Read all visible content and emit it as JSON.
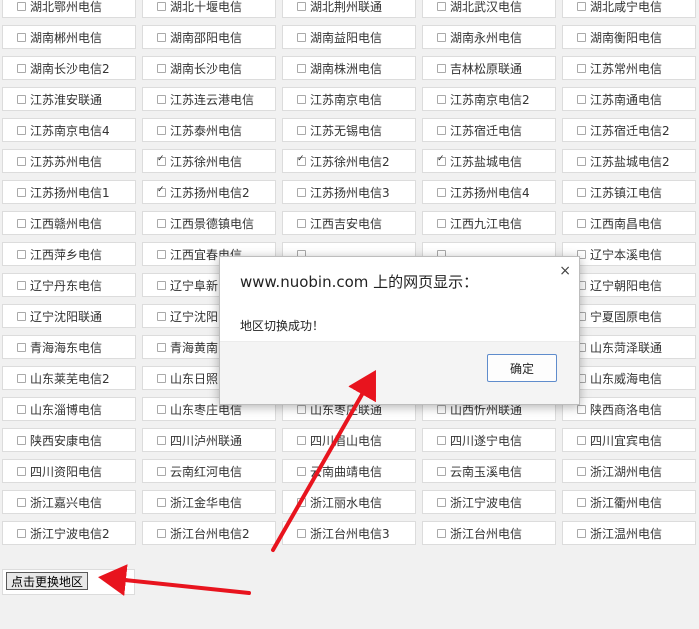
{
  "regions": [
    {
      "label": "湖北鄂州电信",
      "checked": false
    },
    {
      "label": "湖北十堰电信",
      "checked": false
    },
    {
      "label": "湖北荆州联通",
      "checked": false
    },
    {
      "label": "湖北武汉电信",
      "checked": false
    },
    {
      "label": "湖北咸宁电信",
      "checked": false
    },
    {
      "label": "湖南郴州电信",
      "checked": false
    },
    {
      "label": "湖南邵阳电信",
      "checked": false
    },
    {
      "label": "湖南益阳电信",
      "checked": false
    },
    {
      "label": "湖南永州电信",
      "checked": false
    },
    {
      "label": "湖南衡阳电信",
      "checked": false
    },
    {
      "label": "湖南长沙电信2",
      "checked": false
    },
    {
      "label": "湖南长沙电信",
      "checked": false
    },
    {
      "label": "湖南株洲电信",
      "checked": false
    },
    {
      "label": "吉林松原联通",
      "checked": false
    },
    {
      "label": "江苏常州电信",
      "checked": false
    },
    {
      "label": "江苏淮安联通",
      "checked": false
    },
    {
      "label": "江苏连云港电信",
      "checked": false
    },
    {
      "label": "江苏南京电信",
      "checked": false
    },
    {
      "label": "江苏南京电信2",
      "checked": false
    },
    {
      "label": "江苏南通电信",
      "checked": false
    },
    {
      "label": "江苏南京电信4",
      "checked": false
    },
    {
      "label": "江苏泰州电信",
      "checked": false
    },
    {
      "label": "江苏无锡电信",
      "checked": false
    },
    {
      "label": "江苏宿迁电信",
      "checked": false
    },
    {
      "label": "江苏宿迁电信2",
      "checked": false
    },
    {
      "label": "江苏苏州电信",
      "checked": false
    },
    {
      "label": "江苏徐州电信",
      "checked": true
    },
    {
      "label": "江苏徐州电信2",
      "checked": true
    },
    {
      "label": "江苏盐城电信",
      "checked": true
    },
    {
      "label": "江苏盐城电信2",
      "checked": false
    },
    {
      "label": "江苏扬州电信1",
      "checked": false
    },
    {
      "label": "江苏扬州电信2",
      "checked": true
    },
    {
      "label": "江苏扬州电信3",
      "checked": false
    },
    {
      "label": "江苏扬州电信4",
      "checked": false
    },
    {
      "label": "江苏镇江电信",
      "checked": false
    },
    {
      "label": "江西赣州电信",
      "checked": false
    },
    {
      "label": "江西景德镇电信",
      "checked": false
    },
    {
      "label": "江西吉安电信",
      "checked": false
    },
    {
      "label": "江西九江电信",
      "checked": false
    },
    {
      "label": "江西南昌电信",
      "checked": false
    },
    {
      "label": "江西萍乡电信",
      "checked": false
    },
    {
      "label": "江西宜春电信",
      "checked": false
    },
    {
      "label": "",
      "checked": false
    },
    {
      "label": "",
      "checked": false
    },
    {
      "label": "辽宁本溪电信",
      "checked": false
    },
    {
      "label": "辽宁丹东电信",
      "checked": false
    },
    {
      "label": "辽宁阜新",
      "checked": false
    },
    {
      "label": "",
      "checked": false
    },
    {
      "label": "",
      "checked": false
    },
    {
      "label": "辽宁朝阳电信",
      "checked": false
    },
    {
      "label": "辽宁沈阳联通",
      "checked": false
    },
    {
      "label": "辽宁沈阳",
      "checked": false
    },
    {
      "label": "",
      "checked": false
    },
    {
      "label": "",
      "checked": false
    },
    {
      "label": "宁夏固原电信",
      "checked": false
    },
    {
      "label": "青海海东电信",
      "checked": false
    },
    {
      "label": "青海黄南",
      "checked": false
    },
    {
      "label": "",
      "checked": false
    },
    {
      "label": "",
      "checked": false
    },
    {
      "label": "山东菏泽联通",
      "checked": false
    },
    {
      "label": "山东莱芜电信2",
      "checked": false
    },
    {
      "label": "山东日照",
      "checked": false
    },
    {
      "label": "",
      "checked": false
    },
    {
      "label": "",
      "checked": false
    },
    {
      "label": "山东威海电信",
      "checked": false
    },
    {
      "label": "山东淄博电信",
      "checked": false
    },
    {
      "label": "山东枣庄电信",
      "checked": false
    },
    {
      "label": "山东枣庄联通",
      "checked": false
    },
    {
      "label": "山西忻州联通",
      "checked": false
    },
    {
      "label": "陕西商洛电信",
      "checked": false
    },
    {
      "label": "陕西安康电信",
      "checked": false
    },
    {
      "label": "四川泸州联通",
      "checked": false
    },
    {
      "label": "四川眉山电信",
      "checked": false
    },
    {
      "label": "四川遂宁电信",
      "checked": false
    },
    {
      "label": "四川宜宾电信",
      "checked": false
    },
    {
      "label": "四川资阳电信",
      "checked": false
    },
    {
      "label": "云南红河电信",
      "checked": false
    },
    {
      "label": "云南曲靖电信",
      "checked": false
    },
    {
      "label": "云南玉溪电信",
      "checked": false
    },
    {
      "label": "浙江湖州电信",
      "checked": false
    },
    {
      "label": "浙江嘉兴电信",
      "checked": false
    },
    {
      "label": "浙江金华电信",
      "checked": false
    },
    {
      "label": "浙江丽水电信",
      "checked": false
    },
    {
      "label": "浙江宁波电信",
      "checked": false
    },
    {
      "label": "浙江衢州电信",
      "checked": false
    },
    {
      "label": "浙江宁波电信2",
      "checked": false
    },
    {
      "label": "浙江台州电信2",
      "checked": false
    },
    {
      "label": "浙江台州电信3",
      "checked": false
    },
    {
      "label": "浙江台州电信",
      "checked": false
    },
    {
      "label": "浙江温州电信",
      "checked": false
    }
  ],
  "switch_button": {
    "label": "点击更换地区"
  },
  "dialog": {
    "title": "www.nuobin.com 上的网页显示：",
    "message": "地区切换成功！",
    "ok_label": "确定",
    "close_glyph": "×"
  },
  "colors": {
    "arrow": "#e8141e",
    "dialog_ok_border": "#5f8ccc"
  }
}
